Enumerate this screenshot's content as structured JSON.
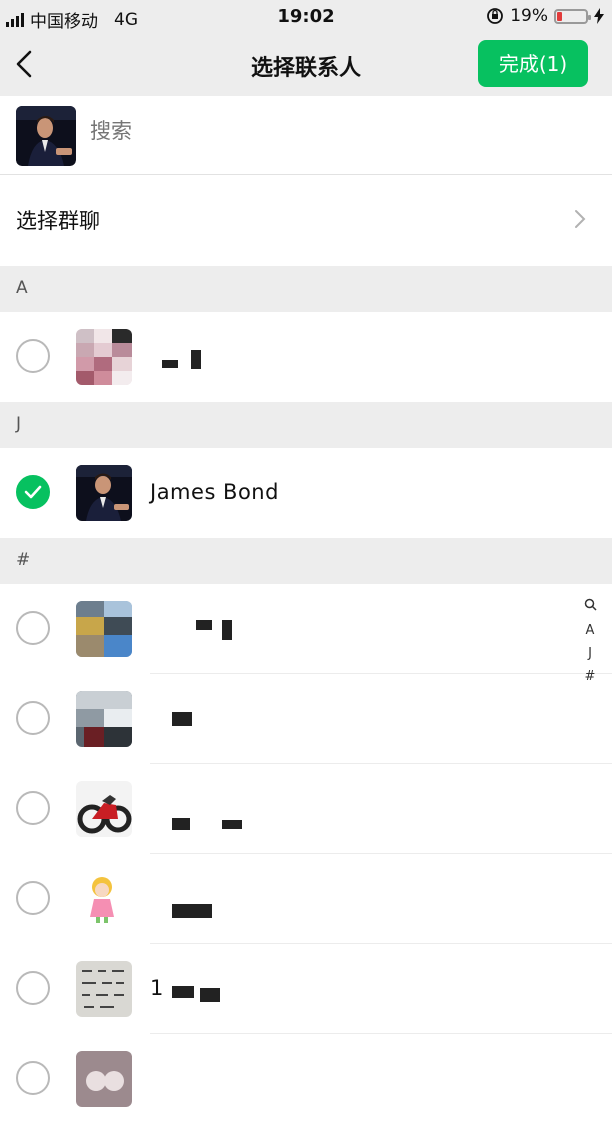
{
  "status_bar": {
    "carrier": "中国移动",
    "network": "4G",
    "time": "19:02",
    "battery": "19%",
    "battery_level": 0.19
  },
  "nav": {
    "title": "选择联系人",
    "done_label": "完成(1)"
  },
  "search": {
    "placeholder": "搜索"
  },
  "group_chat": {
    "label": "选择群聊"
  },
  "sections": [
    {
      "letter": "A",
      "contacts": [
        {
          "name": "",
          "checked": false
        }
      ]
    },
    {
      "letter": "J",
      "contacts": [
        {
          "name": "James  Bond",
          "checked": true
        }
      ]
    },
    {
      "letter": "#",
      "contacts": [
        {
          "name": "",
          "checked": false
        },
        {
          "name": "",
          "checked": false
        },
        {
          "name": "",
          "checked": false
        },
        {
          "name": "",
          "checked": false
        },
        {
          "name": "1",
          "checked": false
        },
        {
          "name": "",
          "checked": false
        }
      ]
    }
  ],
  "index_bar": [
    "A",
    "J",
    "#"
  ],
  "colors": {
    "accent": "#07c160",
    "bar_bg": "#ededed",
    "battery_low": "#e23b3b"
  }
}
